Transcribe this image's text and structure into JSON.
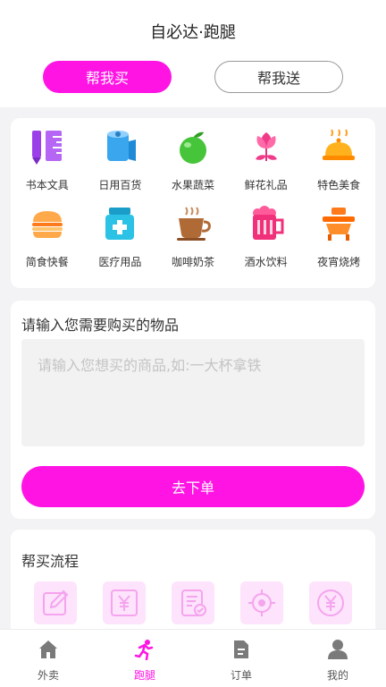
{
  "header": {
    "title": "自必达·跑腿",
    "tabs": [
      {
        "label": "帮我买",
        "active": true
      },
      {
        "label": "帮我送",
        "active": false
      }
    ]
  },
  "categories": [
    {
      "label": "书本文具",
      "icon": "book-stationery-icon"
    },
    {
      "label": "日用百货",
      "icon": "tissue-roll-icon"
    },
    {
      "label": "水果蔬菜",
      "icon": "apple-icon"
    },
    {
      "label": "鲜花礼品",
      "icon": "flower-icon"
    },
    {
      "label": "特色美食",
      "icon": "food-cloche-icon"
    },
    {
      "label": "简食快餐",
      "icon": "burger-icon"
    },
    {
      "label": "医疗用品",
      "icon": "medicine-bottle-icon"
    },
    {
      "label": "咖啡奶茶",
      "icon": "coffee-cup-icon"
    },
    {
      "label": "酒水饮料",
      "icon": "beer-mug-icon"
    },
    {
      "label": "夜宵烧烤",
      "icon": "bbq-grill-icon"
    }
  ],
  "request": {
    "title": "请输入您需要购买的物品",
    "placeholder": "请输入您想买的商品,如:一大杯拿铁",
    "submit_label": "去下单"
  },
  "flow": {
    "title": "帮买流程",
    "steps": [
      "edit-icon",
      "yuan-receipt-icon",
      "checklist-icon",
      "location-target-icon",
      "yuan-coin-icon"
    ]
  },
  "tabbar": {
    "items": [
      {
        "label": "外卖",
        "icon": "home-icon",
        "active": false
      },
      {
        "label": "跑腿",
        "icon": "runner-icon",
        "active": true
      },
      {
        "label": "订单",
        "icon": "order-icon",
        "active": false
      },
      {
        "label": "我的",
        "icon": "user-icon",
        "active": false
      }
    ]
  },
  "colors": {
    "accent": "#ff14e4",
    "background": "#f3f3f5",
    "step_bg": "#fde3fb"
  }
}
